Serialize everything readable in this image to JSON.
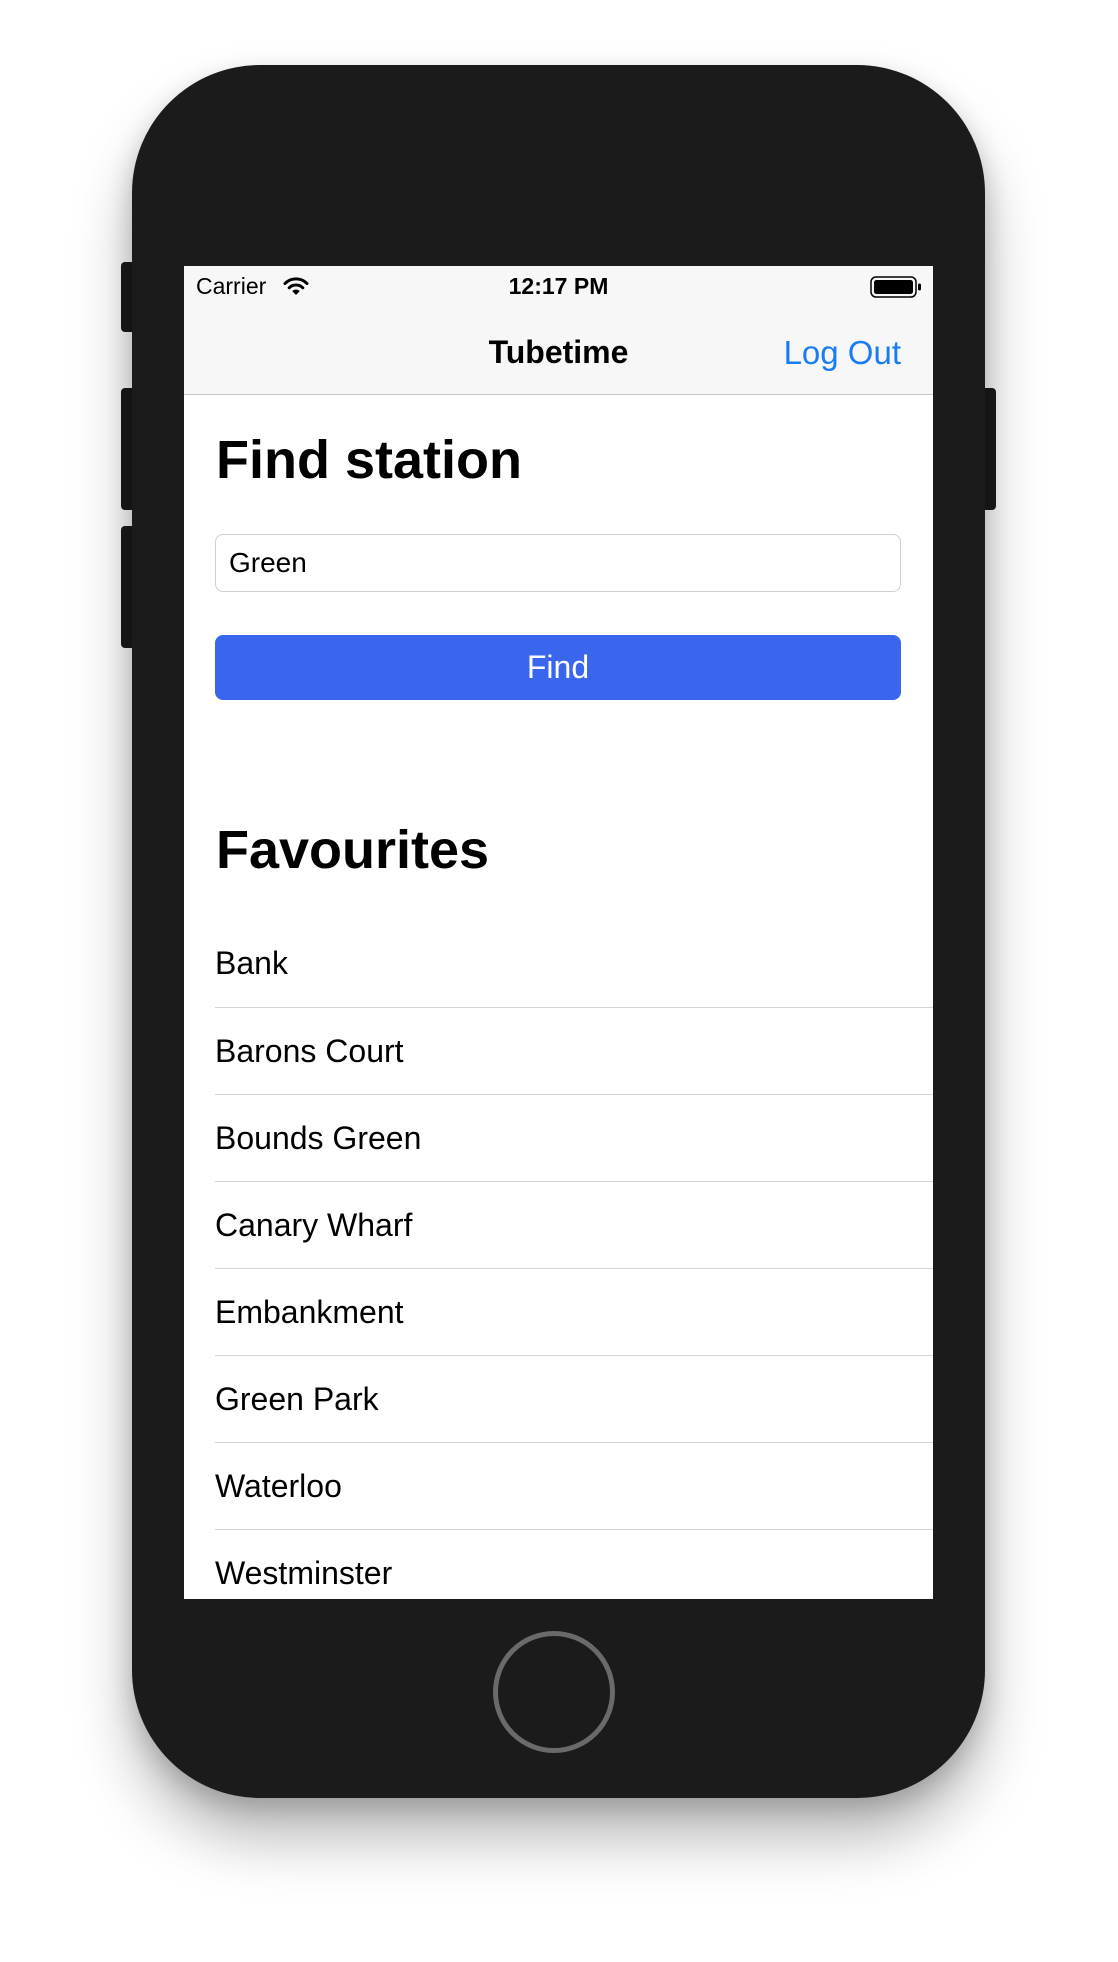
{
  "status_bar": {
    "carrier": "Carrier",
    "time": "12:17 PM",
    "wifi_icon": "wifi-icon",
    "battery_icon": "battery-full-icon"
  },
  "nav_bar": {
    "title": "Tubetime",
    "logout_label": "Log Out",
    "accent_color": "#1a7cf5"
  },
  "find_section": {
    "title": "Find station",
    "search_value": "Green",
    "find_label": "Find",
    "button_color": "#3a66ee"
  },
  "favourites": {
    "title": "Favourites",
    "items": [
      "Bank",
      "Barons Court",
      "Bounds Green",
      "Canary Wharf",
      "Embankment",
      "Green Park",
      "Waterloo",
      "Westminster"
    ]
  },
  "device": {
    "home_button_icon": "home-button-icon"
  }
}
